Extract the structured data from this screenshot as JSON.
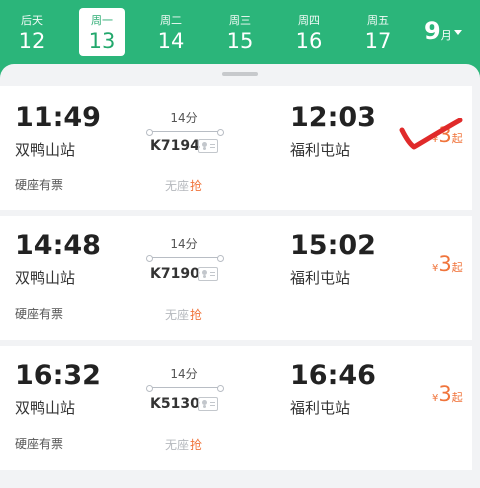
{
  "dates": [
    {
      "weekday": "后天",
      "day": "12"
    },
    {
      "weekday": "周一",
      "day": "13",
      "selected": true
    },
    {
      "weekday": "周二",
      "day": "14"
    },
    {
      "weekday": "周三",
      "day": "15"
    },
    {
      "weekday": "周四",
      "day": "16"
    },
    {
      "weekday": "周五",
      "day": "17"
    }
  ],
  "month": {
    "value": "9",
    "unit": "月"
  },
  "trains": [
    {
      "depart_time": "11:49",
      "depart_station": "双鸭山站",
      "duration": "14分",
      "train_no": "K7194",
      "arrive_time": "12:03",
      "arrive_station": "福利屯站",
      "seat_status": "硬座有票",
      "no_seat": "无座",
      "grab": "抢",
      "price_symbol": "¥",
      "price": "3",
      "price_suffix": "起"
    },
    {
      "depart_time": "14:48",
      "depart_station": "双鸭山站",
      "duration": "14分",
      "train_no": "K7190",
      "arrive_time": "15:02",
      "arrive_station": "福利屯站",
      "seat_status": "硬座有票",
      "no_seat": "无座",
      "grab": "抢",
      "price_symbol": "¥",
      "price": "3",
      "price_suffix": "起"
    },
    {
      "depart_time": "16:32",
      "depart_station": "双鸭山站",
      "duration": "14分",
      "train_no": "K5130",
      "arrive_time": "16:46",
      "arrive_station": "福利屯站",
      "seat_status": "硬座有票",
      "no_seat": "无座",
      "grab": "抢",
      "price_symbol": "¥",
      "price": "3",
      "price_suffix": "起"
    }
  ],
  "colors": {
    "brand": "#2bb57a",
    "price": "#f0743b",
    "check_mark": "#e02a2a"
  }
}
